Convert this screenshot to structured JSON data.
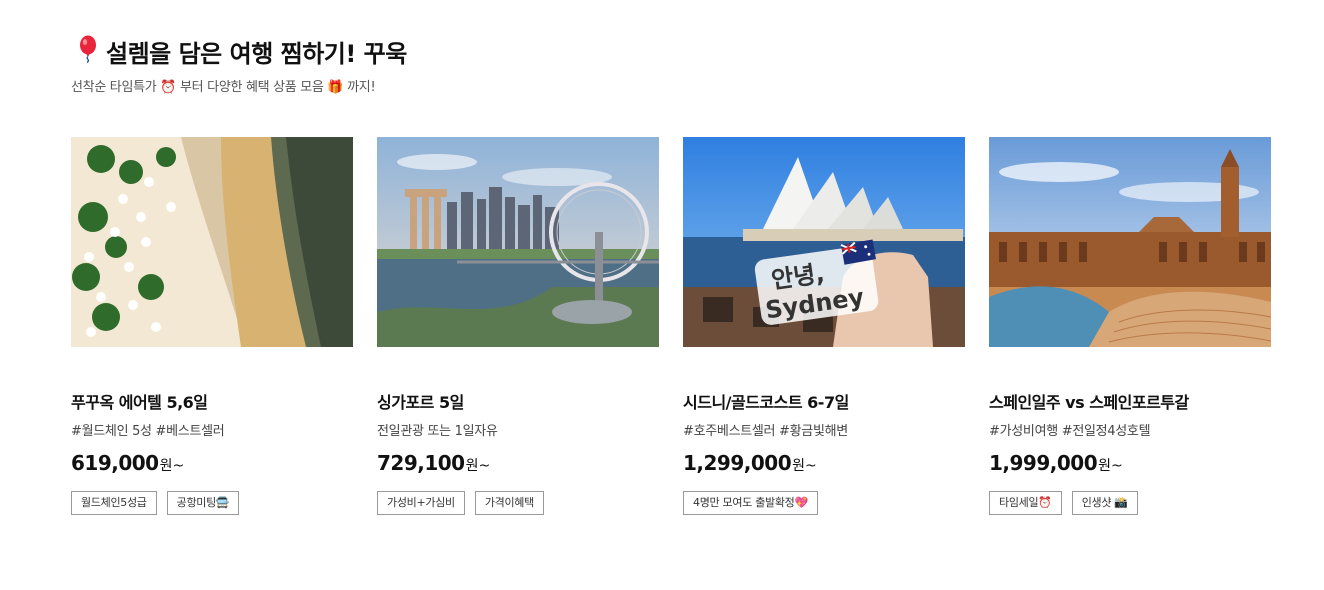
{
  "section": {
    "title_icon": "balloon-icon",
    "title": "설렘을 담은 여행 찜하기! 꾸욱",
    "subtitle": "선착순 타임특가 ⏰ 부터 다양한 혜택 상품 모음 🎁 까지!"
  },
  "products": [
    {
      "image": "beach-resort-aerial-photo",
      "name": "푸꾸옥 에어텔 5,6일",
      "tags": "#월드체인 5성 #베스트셀러",
      "price": "619,000",
      "unit": "원~",
      "badges": [
        "월드체인5성급",
        "공항미팅🚍"
      ]
    },
    {
      "image": "singapore-skyline-photo",
      "name": "싱가포르 5일",
      "tags": "전일관광 또는 1일자유",
      "price": "729,100",
      "unit": "원~",
      "badges": [
        "가성비+가심비",
        "가격이혜택"
      ]
    },
    {
      "image": "sydney-opera-house-photo",
      "name": "시드니/골드코스트 6-7일",
      "tags": "#호주베스트셀러 #황금빛해변",
      "price": "1,299,000",
      "unit": "원~",
      "badges": [
        "4명만 모여도 출발확정💖"
      ],
      "image_text": [
        "안녕,",
        "Sydney"
      ]
    },
    {
      "image": "plaza-de-espana-photo",
      "name": "스페인일주 vs 스페인포르투갈",
      "tags": "#가성비여행 #전일정4성호텔",
      "price": "1,999,000",
      "unit": "원~",
      "badges": [
        "타임세일⏰",
        "인생샷 📸"
      ]
    }
  ]
}
